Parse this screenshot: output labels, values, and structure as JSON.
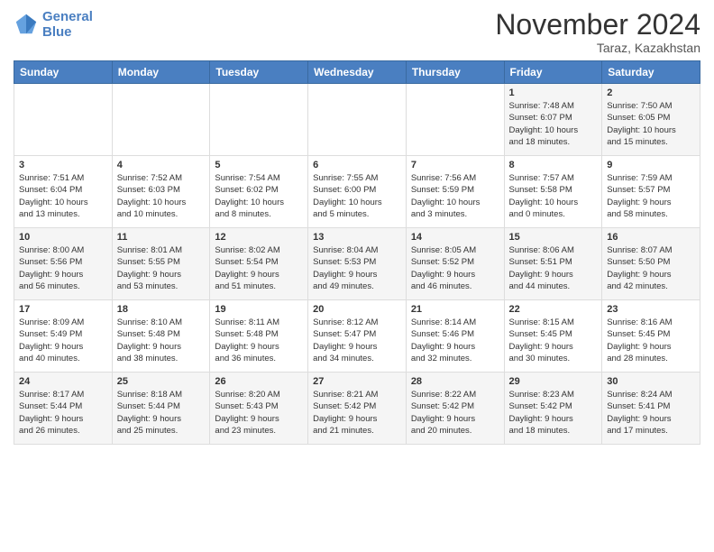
{
  "logo": {
    "line1": "General",
    "line2": "Blue"
  },
  "title": "November 2024",
  "location": "Taraz, Kazakhstan",
  "days_header": [
    "Sunday",
    "Monday",
    "Tuesday",
    "Wednesday",
    "Thursday",
    "Friday",
    "Saturday"
  ],
  "weeks": [
    [
      {
        "day": "",
        "info": ""
      },
      {
        "day": "",
        "info": ""
      },
      {
        "day": "",
        "info": ""
      },
      {
        "day": "",
        "info": ""
      },
      {
        "day": "",
        "info": ""
      },
      {
        "day": "1",
        "info": "Sunrise: 7:48 AM\nSunset: 6:07 PM\nDaylight: 10 hours\nand 18 minutes."
      },
      {
        "day": "2",
        "info": "Sunrise: 7:50 AM\nSunset: 6:05 PM\nDaylight: 10 hours\nand 15 minutes."
      }
    ],
    [
      {
        "day": "3",
        "info": "Sunrise: 7:51 AM\nSunset: 6:04 PM\nDaylight: 10 hours\nand 13 minutes."
      },
      {
        "day": "4",
        "info": "Sunrise: 7:52 AM\nSunset: 6:03 PM\nDaylight: 10 hours\nand 10 minutes."
      },
      {
        "day": "5",
        "info": "Sunrise: 7:54 AM\nSunset: 6:02 PM\nDaylight: 10 hours\nand 8 minutes."
      },
      {
        "day": "6",
        "info": "Sunrise: 7:55 AM\nSunset: 6:00 PM\nDaylight: 10 hours\nand 5 minutes."
      },
      {
        "day": "7",
        "info": "Sunrise: 7:56 AM\nSunset: 5:59 PM\nDaylight: 10 hours\nand 3 minutes."
      },
      {
        "day": "8",
        "info": "Sunrise: 7:57 AM\nSunset: 5:58 PM\nDaylight: 10 hours\nand 0 minutes."
      },
      {
        "day": "9",
        "info": "Sunrise: 7:59 AM\nSunset: 5:57 PM\nDaylight: 9 hours\nand 58 minutes."
      }
    ],
    [
      {
        "day": "10",
        "info": "Sunrise: 8:00 AM\nSunset: 5:56 PM\nDaylight: 9 hours\nand 56 minutes."
      },
      {
        "day": "11",
        "info": "Sunrise: 8:01 AM\nSunset: 5:55 PM\nDaylight: 9 hours\nand 53 minutes."
      },
      {
        "day": "12",
        "info": "Sunrise: 8:02 AM\nSunset: 5:54 PM\nDaylight: 9 hours\nand 51 minutes."
      },
      {
        "day": "13",
        "info": "Sunrise: 8:04 AM\nSunset: 5:53 PM\nDaylight: 9 hours\nand 49 minutes."
      },
      {
        "day": "14",
        "info": "Sunrise: 8:05 AM\nSunset: 5:52 PM\nDaylight: 9 hours\nand 46 minutes."
      },
      {
        "day": "15",
        "info": "Sunrise: 8:06 AM\nSunset: 5:51 PM\nDaylight: 9 hours\nand 44 minutes."
      },
      {
        "day": "16",
        "info": "Sunrise: 8:07 AM\nSunset: 5:50 PM\nDaylight: 9 hours\nand 42 minutes."
      }
    ],
    [
      {
        "day": "17",
        "info": "Sunrise: 8:09 AM\nSunset: 5:49 PM\nDaylight: 9 hours\nand 40 minutes."
      },
      {
        "day": "18",
        "info": "Sunrise: 8:10 AM\nSunset: 5:48 PM\nDaylight: 9 hours\nand 38 minutes."
      },
      {
        "day": "19",
        "info": "Sunrise: 8:11 AM\nSunset: 5:48 PM\nDaylight: 9 hours\nand 36 minutes."
      },
      {
        "day": "20",
        "info": "Sunrise: 8:12 AM\nSunset: 5:47 PM\nDaylight: 9 hours\nand 34 minutes."
      },
      {
        "day": "21",
        "info": "Sunrise: 8:14 AM\nSunset: 5:46 PM\nDaylight: 9 hours\nand 32 minutes."
      },
      {
        "day": "22",
        "info": "Sunrise: 8:15 AM\nSunset: 5:45 PM\nDaylight: 9 hours\nand 30 minutes."
      },
      {
        "day": "23",
        "info": "Sunrise: 8:16 AM\nSunset: 5:45 PM\nDaylight: 9 hours\nand 28 minutes."
      }
    ],
    [
      {
        "day": "24",
        "info": "Sunrise: 8:17 AM\nSunset: 5:44 PM\nDaylight: 9 hours\nand 26 minutes."
      },
      {
        "day": "25",
        "info": "Sunrise: 8:18 AM\nSunset: 5:44 PM\nDaylight: 9 hours\nand 25 minutes."
      },
      {
        "day": "26",
        "info": "Sunrise: 8:20 AM\nSunset: 5:43 PM\nDaylight: 9 hours\nand 23 minutes."
      },
      {
        "day": "27",
        "info": "Sunrise: 8:21 AM\nSunset: 5:42 PM\nDaylight: 9 hours\nand 21 minutes."
      },
      {
        "day": "28",
        "info": "Sunrise: 8:22 AM\nSunset: 5:42 PM\nDaylight: 9 hours\nand 20 minutes."
      },
      {
        "day": "29",
        "info": "Sunrise: 8:23 AM\nSunset: 5:42 PM\nDaylight: 9 hours\nand 18 minutes."
      },
      {
        "day": "30",
        "info": "Sunrise: 8:24 AM\nSunset: 5:41 PM\nDaylight: 9 hours\nand 17 minutes."
      }
    ]
  ]
}
